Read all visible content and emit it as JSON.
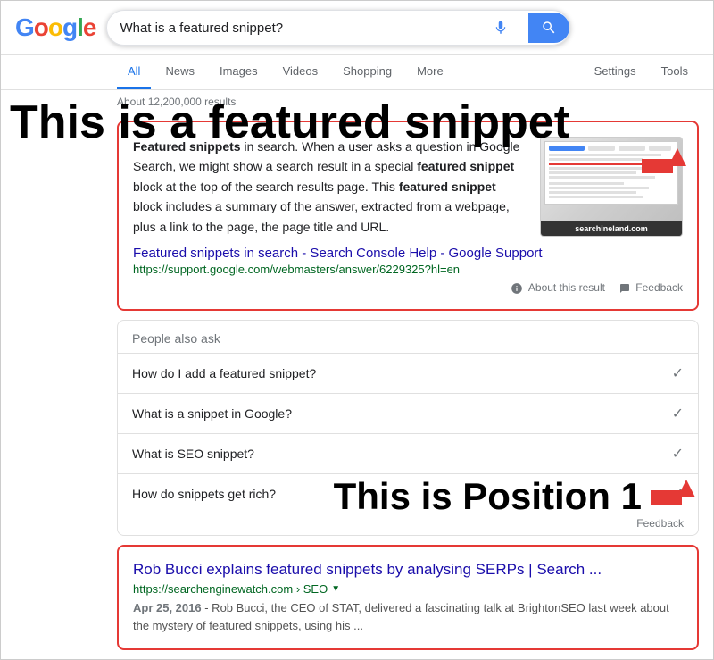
{
  "header": {
    "logo": "Google",
    "search_query": "What is a featured snippet?",
    "search_placeholder": "Search"
  },
  "nav": {
    "tabs": [
      {
        "label": "All",
        "active": true
      },
      {
        "label": "News",
        "active": false
      },
      {
        "label": "Images",
        "active": false
      },
      {
        "label": "Videos",
        "active": false
      },
      {
        "label": "Shopping",
        "active": false
      },
      {
        "label": "More",
        "active": false
      }
    ],
    "right_tabs": [
      {
        "label": "Settings"
      },
      {
        "label": "Tools"
      }
    ]
  },
  "results_info": "About 12,200,000 results",
  "overlay": {
    "featured_text": "This is a featured snippet",
    "position_text": "This is Position 1"
  },
  "featured_snippet": {
    "body": "Featured snippets in search. When a user asks a question in Google Search, we might show a search result in a special featured snippet block at the top of the search results page. This featured snippet block includes a summary of the answer, extracted from a webpage, plus a link to the page, the page title and URL.",
    "image_label": "searchineland.com",
    "link_text": "Featured snippets in search - Search Console Help - Google Support",
    "link_url": "https://support.google.com/webmasters/answer/6229325?hl=en",
    "about_label": "About this result",
    "feedback_label": "Feedback"
  },
  "people_also_ask": {
    "title": "People also ask",
    "items": [
      {
        "question": "How do I add a featured snippet?"
      },
      {
        "question": "What is a snippet in Google?"
      },
      {
        "question": "What is SEO snippet?"
      },
      {
        "question": "How do snippets get rich?"
      }
    ],
    "feedback_label": "Feedback"
  },
  "position1": {
    "link_text": "Rob Bucci explains featured snippets by analysing SERPs | Search ...",
    "url": "https://searchenginewatch.com › SEO",
    "date": "Apr 25, 2016",
    "snippet": "Rob Bucci, the CEO of STAT, delivered a fascinating talk at BrightonSEO last week about the mystery of featured snippets, using his ..."
  }
}
